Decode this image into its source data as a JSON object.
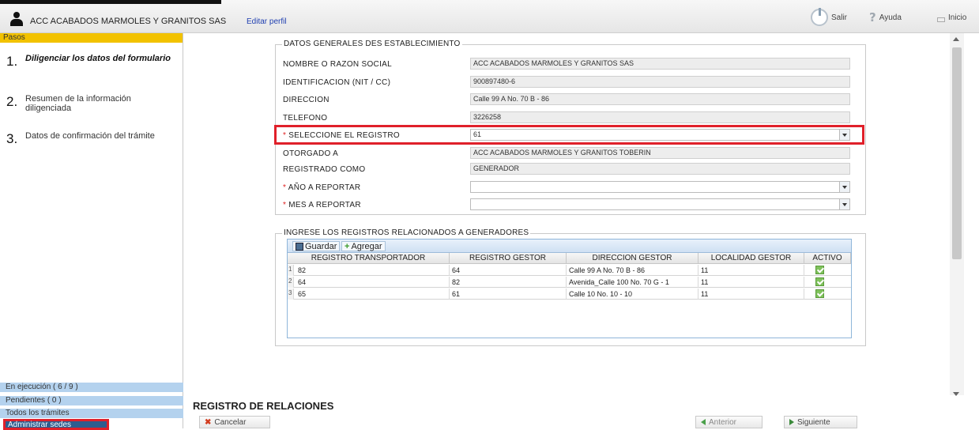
{
  "header": {
    "company_name": "ACC ACABADOS MARMOLES Y GRANITOS SAS",
    "edit_profile": "Editar perfil",
    "salir": "Salir",
    "ayuda": "Ayuda",
    "inicio": "Inicio"
  },
  "sidebar": {
    "pasos": "Pasos",
    "steps": [
      {
        "num": "1.",
        "label": "Diligenciar los datos del formulario"
      },
      {
        "num": "2.",
        "label": "Resumen de la información diligenciada"
      },
      {
        "num": "3.",
        "label": "Datos de confirmación del trámite"
      }
    ],
    "links": {
      "en_ejecucion": "En ejecución ( 6 / 9 )",
      "pendientes": "Pendientes ( 0 )",
      "todos": "Todos los trámites",
      "administrar": "Administrar sedes"
    }
  },
  "general": {
    "legend": "DATOS GENERALES DES ESTABLECIMIENTO",
    "fields": {
      "nombre": {
        "label": "NOMBRE O RAZON SOCIAL",
        "value": "ACC ACABADOS MARMOLES Y GRANITOS SAS"
      },
      "identificacion": {
        "label": "IDENTIFICACION (NIT / CC)",
        "value": "900897480-6"
      },
      "direccion": {
        "label": "DIRECCION",
        "value": "Calle 99 A No. 70 B - 86"
      },
      "telefono": {
        "label": "TELEFONO",
        "value": "3226258"
      },
      "registro": {
        "label": "SELECCIONE EL REGISTRO",
        "value": "61"
      },
      "otorgado": {
        "label": "OTORGADO A",
        "value": "ACC ACABADOS MARMOLES Y GRANITOS TOBERIN"
      },
      "registrado": {
        "label": "REGISTRADO COMO",
        "value": "GENERADOR"
      },
      "anio": {
        "label": "AÑO A REPORTAR",
        "value": ""
      },
      "mes": {
        "label": "MES A REPORTAR",
        "value": ""
      }
    }
  },
  "registros": {
    "legend": "INGRESE LOS REGISTROS RELACIONADOS A GENERADORES",
    "toolbar": {
      "guardar": "Guardar",
      "agregar": "Agregar"
    },
    "columns": [
      "REGISTRO TRANSPORTADOR",
      "REGISTRO GESTOR",
      "DIRECCION GESTOR",
      "LOCALIDAD GESTOR",
      "ACTIVO"
    ],
    "rows": [
      {
        "n": "1",
        "transportador": "82",
        "gestor": "64",
        "direccion": "Calle 99 A No. 70 B - 86",
        "localidad": "11",
        "activo": true
      },
      {
        "n": "2",
        "transportador": "64",
        "gestor": "82",
        "direccion": "Avenida_Calle 100 No. 70 G - 1",
        "localidad": "11",
        "activo": true
      },
      {
        "n": "3",
        "transportador": "65",
        "gestor": "61",
        "direccion": "Calle 10 No. 10 - 10",
        "localidad": "11",
        "activo": true
      }
    ]
  },
  "footer": {
    "section_title": "REGISTRO DE RELACIONES",
    "cancelar": "Cancelar",
    "anterior": "Anterior",
    "siguiente": "Siguiente"
  },
  "colors": {
    "accent_yellow": "#f2c200",
    "highlight_red": "#e0202a",
    "nav_blue": "#b4d2ee",
    "dark_blue": "#2d5d8f"
  },
  "icons": [
    "user-icon",
    "power-icon",
    "help-icon",
    "home-icon",
    "save-icon",
    "add-icon",
    "cancel-icon",
    "arrow-left-icon",
    "arrow-right-icon",
    "checkbox-icon",
    "chevron-down-icon"
  ]
}
